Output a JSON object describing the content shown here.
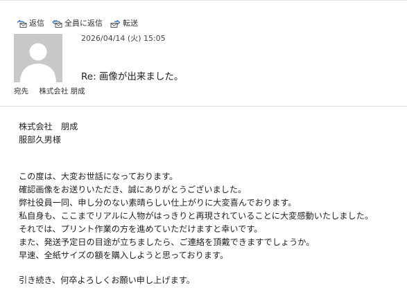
{
  "toolbar": {
    "reply_label": "返信",
    "reply_all_label": "全員に返信",
    "forward_label": "転送"
  },
  "message": {
    "date": "2026/04/14 (火) 15:05",
    "subject": "Re: 画像が出来ました。",
    "to_label": "宛先",
    "to": "株式会社 朋成"
  },
  "body": {
    "lines": [
      "株式会社　朋成",
      "服部久男様",
      "",
      "",
      "この度は、大変お世話になっております。",
      "確認画像をお送りいただき、誠にありがとうございました。",
      "弊社役員一同、申し分のない素晴らしい仕上がりに大変喜んでおります。",
      "私自身も、ここまでリアルに人物がはっきりと再現されていることに大変感動いたしました。",
      "それでは、プリント作業の方を進めていただけますと幸いです。",
      "また、発送予定日の目途が立ちましたら、ご連絡を頂戴できますでしょうか。",
      "早速、全紙サイズの額を購入しようと思っております。",
      "",
      "引き続き、何卒よろしくお願い申し上げます。"
    ]
  },
  "icons": {
    "reply": "reply-icon",
    "reply_all": "reply-all-icon",
    "forward": "forward-icon",
    "avatar": "person-icon"
  },
  "colors": {
    "icon_blue": "#3b6fb6",
    "avatar_bg": "#c8c8c8",
    "avatar_figure": "#ffffff"
  }
}
